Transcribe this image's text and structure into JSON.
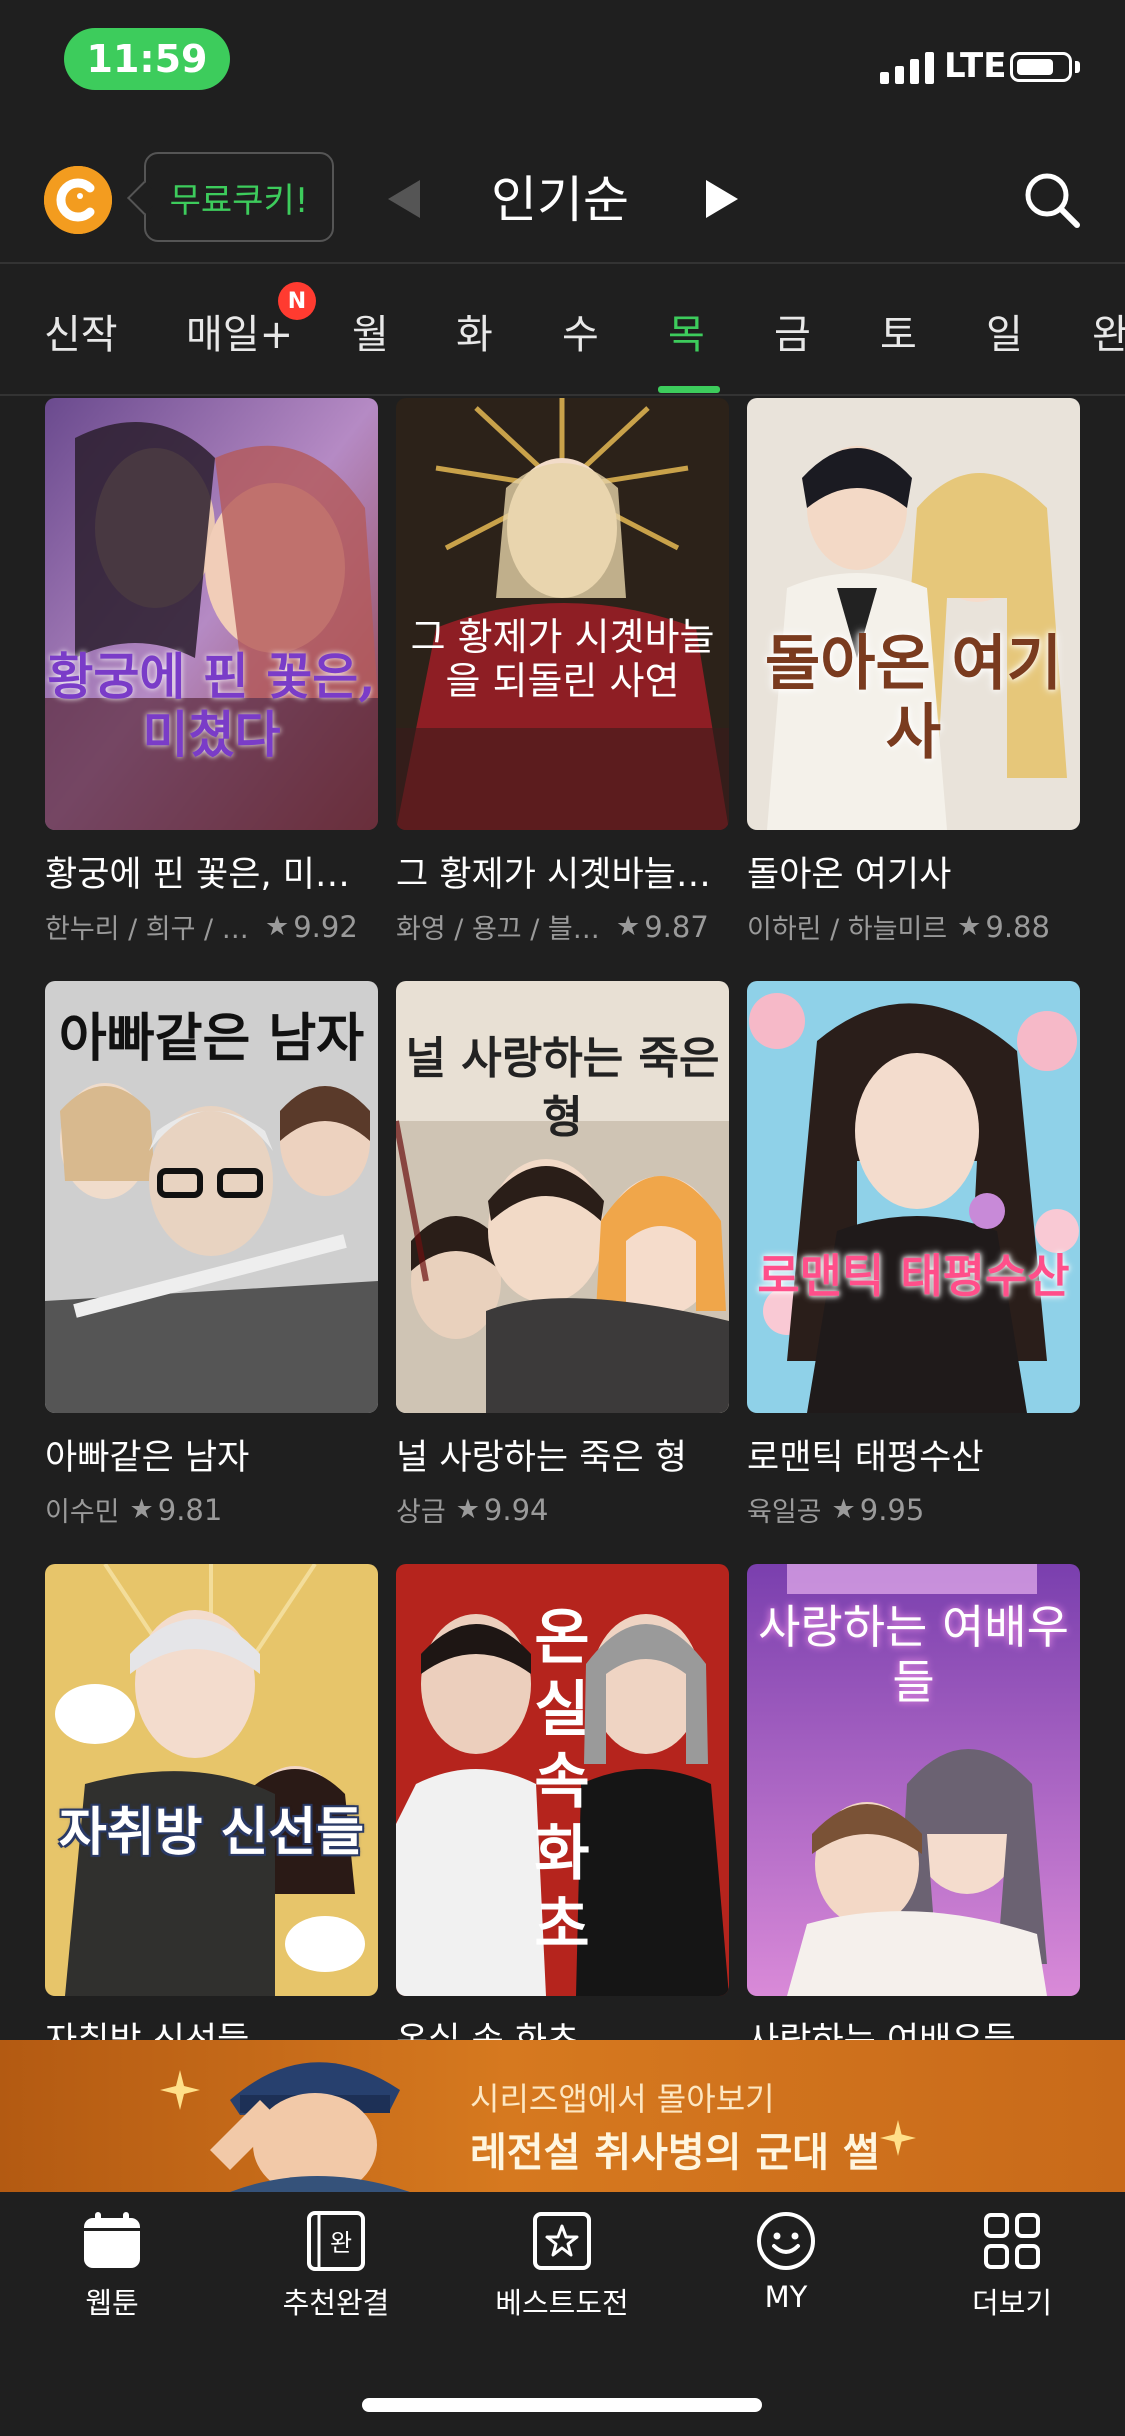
{
  "status_bar": {
    "time": "11:59",
    "network": "LTE"
  },
  "topbar": {
    "free_cookie_label": "무료쿠키!",
    "sort_label": "인기순",
    "logo_icon": "cookie-logo-icon",
    "search_icon": "search-icon"
  },
  "tabs": {
    "items": [
      "신작",
      "매일+",
      "월",
      "화",
      "수",
      "목",
      "금",
      "토",
      "일",
      "완"
    ],
    "active": "목",
    "new_badge": "N",
    "accent_color": "#3dcc5c"
  },
  "comics": [
    {
      "title": "황궁에 핀 꽃은, 미…",
      "authors": "한누리 / 희구 / 성소작",
      "rating": "9.92",
      "cover_text": "황궁에 핀 꽃은,미쳤다"
    },
    {
      "title": "그 황제가 시곗바늘…",
      "authors": "화영 / 용끄 / 블루밍…",
      "rating": "9.87",
      "cover_text": "그 황제가 시곗바늘을 되돌린 사연"
    },
    {
      "title": "돌아온 여기사",
      "authors": "이하린 / 하늘미르",
      "rating": "9.88",
      "cover_text": "돌아온 여기사"
    },
    {
      "title": "아빠같은 남자",
      "authors": "이수민",
      "rating": "9.81",
      "cover_text": "아빠같은 남자"
    },
    {
      "title": "널 사랑하는 죽은 형",
      "authors": "상금",
      "rating": "9.94",
      "cover_text": "널 사랑하는 죽은 형"
    },
    {
      "title": "로맨틱 태평수산",
      "authors": "육일공",
      "rating": "9.95",
      "cover_text": "로맨틱 태평수산"
    },
    {
      "title": "자취방 신선들",
      "cover_text": "자취방 신선들"
    },
    {
      "title": "온실 속 화초",
      "cover_text": "온실속화초"
    },
    {
      "title": "사랑하는 여배우들",
      "cover_text": "사랑하는 여배우들"
    }
  ],
  "banner": {
    "line1": "시리즈앱에서 몰아보기",
    "line2": "레전설 취사병의 군대 썰"
  },
  "bottom_nav": [
    {
      "label": "웹툰",
      "icon": "calendar-icon"
    },
    {
      "label": "추천완결",
      "icon": "completed-book-icon",
      "icon_text": "완"
    },
    {
      "label": "베스트도전",
      "icon": "star-icon"
    },
    {
      "label": "MY",
      "icon": "smiley-icon"
    },
    {
      "label": "더보기",
      "icon": "grid-icon"
    }
  ]
}
